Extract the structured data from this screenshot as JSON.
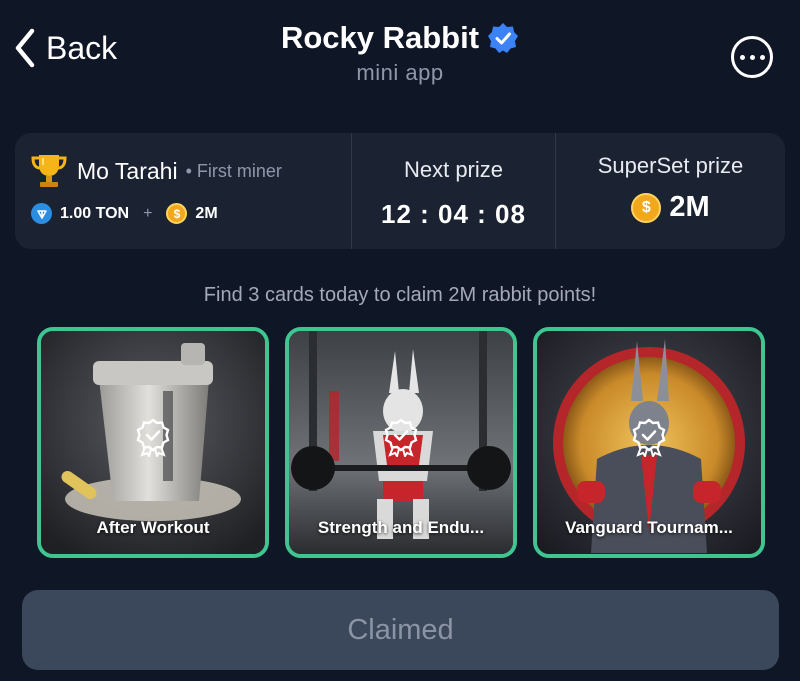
{
  "header": {
    "back_label": "Back",
    "title": "Rocky Rabbit",
    "subtitle": "mini app"
  },
  "panel": {
    "miner_name": "Mo Tarahi",
    "miner_tag": "• First miner",
    "ton_amount": "1.00 TON",
    "plus": "+",
    "coin_amount": "2M",
    "next_prize_label": "Next prize",
    "timer": "12 : 04 : 08",
    "superset_label": "SuperSet prize",
    "superset_amount": "2M"
  },
  "hint": "Find 3 cards today to claim 2M rabbit points!",
  "cards": [
    {
      "label": "After Workout"
    },
    {
      "label": "Strength and Endu..."
    },
    {
      "label": "Vanguard Tournam..."
    }
  ],
  "claim_button": {
    "label": "Claimed"
  },
  "coin_symbol": "$",
  "colors": {
    "background": "#0f1626",
    "panel": "#1b2333",
    "card_border": "#40c590",
    "verified": "#3b82f6",
    "coin": "#f2a81d",
    "ton": "#2b8ee0",
    "button": "#3b475a"
  },
  "icons": [
    "chevron-left-icon",
    "verified-badge-icon",
    "more-options-icon",
    "trophy-icon",
    "ton-icon",
    "coin-icon",
    "achievement-badge-icon"
  ]
}
